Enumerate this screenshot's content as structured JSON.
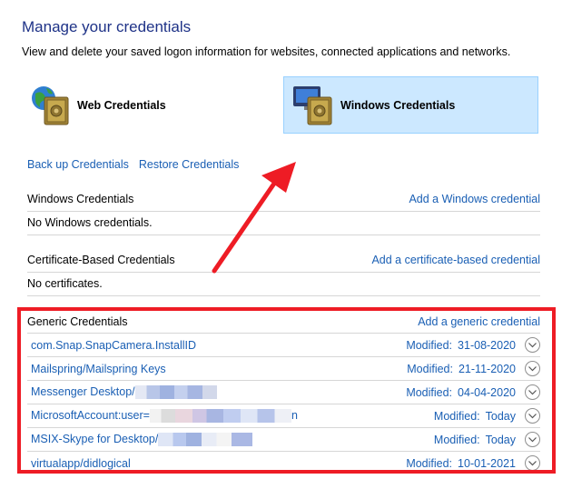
{
  "header": {
    "title": "Manage your credentials",
    "subtitle": "View and delete your saved logon information for websites, connected applications and networks."
  },
  "cred_types": {
    "web_label": "Web Credentials",
    "windows_label": "Windows Credentials"
  },
  "links": {
    "backup": "Back up Credentials",
    "restore": "Restore Credentials"
  },
  "sections": {
    "windows": {
      "title": "Windows Credentials",
      "action": "Add a Windows credential",
      "empty": "No Windows credentials."
    },
    "certificate": {
      "title": "Certificate-Based Credentials",
      "action": "Add a certificate-based credential",
      "empty": "No certificates."
    },
    "generic": {
      "title": "Generic Credentials",
      "action": "Add a generic credential",
      "items": [
        {
          "name": "com.Snap.SnapCamera.InstallID",
          "modified_label": "Modified:",
          "modified": "31-08-2020"
        },
        {
          "name": "Mailspring/Mailspring Keys",
          "modified_label": "Modified:",
          "modified": "21-11-2020"
        },
        {
          "name": "Messenger Desktop/",
          "modified_label": "Modified:",
          "modified": "04-04-2020"
        },
        {
          "name": "MicrosoftAccount:user=",
          "name_tail": "n",
          "modified_label": "Modified:",
          "modified": "Today"
        },
        {
          "name": "MSIX-Skype for Desktop/",
          "modified_label": "Modified:",
          "modified": "Today"
        },
        {
          "name": "virtualapp/didlogical",
          "modified_label": "Modified:",
          "modified": "10-01-2021"
        }
      ]
    }
  },
  "annotation": {
    "highlight_color": "#ee1c25"
  },
  "icons": [
    "globe-vault-icon",
    "monitor-vault-icon",
    "chevron-down-icon"
  ]
}
